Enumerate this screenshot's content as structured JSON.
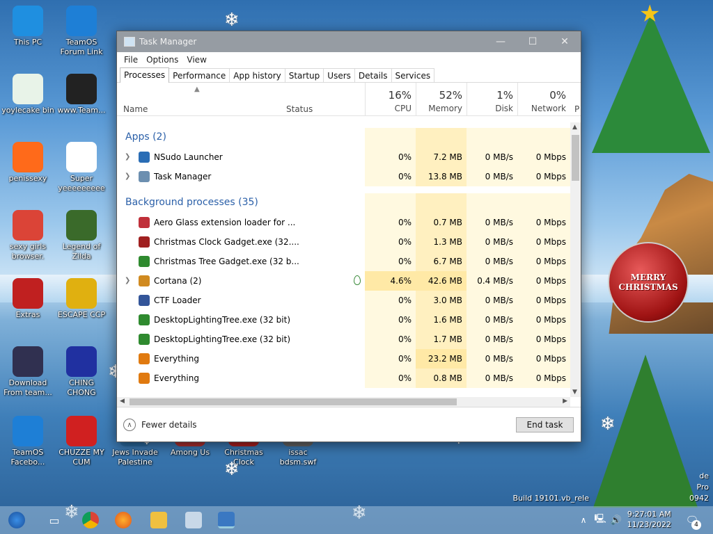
{
  "desktop_icons": [
    {
      "label": "This PC",
      "icon": "computer-icon"
    },
    {
      "label": "TeamOS Forum Link",
      "icon": "gear-icon"
    },
    {
      "label": "yoylecake bin",
      "icon": "recycle-bin-icon"
    },
    {
      "label": "www.Team...",
      "icon": "book-icon"
    },
    {
      "label": "penissexy",
      "icon": "firefox-icon"
    },
    {
      "label": "Super yeeeeeeeee",
      "icon": "dog-icon"
    },
    {
      "label": "sexy girls browser.",
      "icon": "chrome-icon"
    },
    {
      "label": "Legend of Zilda",
      "icon": "zelda-icon"
    },
    {
      "label": "Extras",
      "icon": "gift-icon"
    },
    {
      "label": "ESCAPE CCP",
      "icon": "escape-icon"
    },
    {
      "label": "Download From team...",
      "icon": "download-icon"
    },
    {
      "label": "CHING CHONG",
      "icon": "orb-icon"
    },
    {
      "label": "TeamOS Facebo...",
      "icon": "gear-icon"
    },
    {
      "label": "CHUZZE MY CUM",
      "icon": "chuzzle-icon"
    },
    {
      "label": "Jews Invade Palestine",
      "icon": "game-icon"
    },
    {
      "label": "Among Us",
      "icon": "game-icon"
    },
    {
      "label": "Christmas Clock",
      "icon": "clock-icon"
    },
    {
      "label": "issac bdsm.swf",
      "icon": "swf-icon"
    }
  ],
  "window": {
    "title": "Task Manager",
    "minimize": "—",
    "maximize": "☐",
    "close": "✕"
  },
  "menu": [
    "File",
    "Options",
    "View"
  ],
  "tabs": [
    "Processes",
    "Performance",
    "App history",
    "Startup",
    "Users",
    "Details",
    "Services"
  ],
  "header": {
    "name": "Name",
    "status": "Status",
    "more": "P",
    "columns": [
      {
        "pct": "16%",
        "name": "CPU"
      },
      {
        "pct": "52%",
        "name": "Memory"
      },
      {
        "pct": "1%",
        "name": "Disk"
      },
      {
        "pct": "0%",
        "name": "Network"
      }
    ]
  },
  "groups": {
    "apps": "Apps (2)",
    "background": "Background processes (35)"
  },
  "apps": [
    {
      "name": "NSudo Launcher",
      "cpu": "0%",
      "memory": "7.2 MB",
      "disk": "0 MB/s",
      "network": "0 Mbps",
      "expandable": true,
      "icon_color": "#2a6db5"
    },
    {
      "name": "Task Manager",
      "cpu": "0%",
      "memory": "13.8 MB",
      "disk": "0 MB/s",
      "network": "0 Mbps",
      "expandable": true,
      "icon_color": "#6c8fb0"
    }
  ],
  "background": [
    {
      "name": "Aero Glass extension loader for ...",
      "cpu": "0%",
      "memory": "0.7 MB",
      "disk": "0 MB/s",
      "network": "0 Mbps",
      "expandable": false,
      "icon_color": "#c0303a"
    },
    {
      "name": "Christmas Clock Gadget.exe (32....",
      "cpu": "0%",
      "memory": "1.3 MB",
      "disk": "0 MB/s",
      "network": "0 Mbps",
      "expandable": false,
      "icon_color": "#a02020"
    },
    {
      "name": "Christmas Tree Gadget.exe (32 b...",
      "cpu": "0%",
      "memory": "6.7 MB",
      "disk": "0 MB/s",
      "network": "0 Mbps",
      "expandable": false,
      "icon_color": "#2f8a2f"
    },
    {
      "name": "Cortana (2)",
      "cpu": "4.6%",
      "memory": "42.6 MB",
      "disk": "0.4 MB/s",
      "network": "0 Mbps",
      "expandable": true,
      "icon_color": "#d08a20"
    },
    {
      "name": "CTF Loader",
      "cpu": "0%",
      "memory": "3.0 MB",
      "disk": "0 MB/s",
      "network": "0 Mbps",
      "expandable": false,
      "icon_color": "#335599"
    },
    {
      "name": "DesktopLightingTree.exe (32 bit)",
      "cpu": "0%",
      "memory": "1.6 MB",
      "disk": "0 MB/s",
      "network": "0 Mbps",
      "expandable": false,
      "icon_color": "#2f8a2f"
    },
    {
      "name": "DesktopLightingTree.exe (32 bit)",
      "cpu": "0%",
      "memory": "1.7 MB",
      "disk": "0 MB/s",
      "network": "0 Mbps",
      "expandable": false,
      "icon_color": "#2f8a2f"
    },
    {
      "name": "Everything",
      "cpu": "0%",
      "memory": "23.2 MB",
      "disk": "0 MB/s",
      "network": "0 Mbps",
      "expandable": false,
      "icon_color": "#e07a10"
    },
    {
      "name": "Everything",
      "cpu": "0%",
      "memory": "0.8 MB",
      "disk": "0 MB/s",
      "network": "0 Mbps",
      "expandable": false,
      "icon_color": "#e07a10"
    }
  ],
  "footer": {
    "fewer_details": "Fewer details",
    "end_task": "End task"
  },
  "ornament_text": "MERRY CHRISTMAS",
  "watermark": {
    "build": "Build 19101.vb_rele",
    "suffix1": "de",
    "suffix2": "Pro",
    "suffix3": "0942"
  },
  "clock": {
    "time": "9:27:01 AM",
    "date": "11/23/2022"
  },
  "notifications": "4",
  "colors": {
    "accent": "#2a5fa8",
    "heat_light": "#fff9e0",
    "heat_med": "#fff0c0",
    "heat_strong": "#ffe9a6"
  }
}
